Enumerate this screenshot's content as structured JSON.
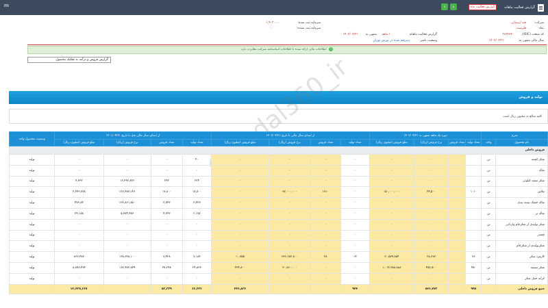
{
  "topbar": {
    "title": "گزارش فعالیت ماهانه",
    "corner": "EN",
    "report_badge": "گزارش فعالیت ماه"
  },
  "info": {
    "company_label": "شرکت:",
    "company_value": "قند لرستان",
    "symbol_label": "نماد:",
    "symbol_value": "قلرست",
    "code_label": "کد صنعت (ISIC):",
    "code_value": "۳۸۳۲۸۲",
    "period_label": "سال مالی منتهی به:",
    "period_value": "۱۴۰۲/۰۳/۳۱",
    "capital_label": "سرمایه ثبت شده:",
    "capital_value": "۱,۹۰۳,۰۰۰",
    "unreg_capital_label": "سرمایه ثبت نشده:",
    "unreg_capital_value": "۰",
    "report_label": "گزارش فعالیت ماهانه",
    "report_period": "۱ ماهه",
    "report_end_label": "منتهی به",
    "report_end_value": "۱۴۰۲/۰۴/۳۱",
    "status_label": "وضعیت ناشر:",
    "status_value": "پذیرفته شده در بورس تهران"
  },
  "notice": "اطلاعات مالی ارائه شده با اطلاعات اساسنامه شرکت مغایرت دارد",
  "select_value": "گزارش فروش و درآمد به تفکیک محصول",
  "section_title": "تولید و فروش",
  "hint": "کلیه مبالغ به میلیون ریال است",
  "table": {
    "headers_top": {
      "desc": "شرح",
      "period1": "دوره یک ماهه منتهی به ۱۴۰۲/۰۴/۳۱",
      "period2": "از ابتدای سال مالی تا تاریخ ۱۴۰۲/۰۴/۳۱",
      "period3": "از ابتدای سال مالی قبل تا تاریخ ۱۴۰۱/۰۴/۳۱",
      "status": "وضعیت محصول-واحد"
    },
    "headers_sub": [
      "نام محصول",
      "واحد",
      "تعداد تولید",
      "تعداد فروش",
      "نرخ فروش (ریال)",
      "مبلغ فروش (میلیون ریال)",
      "تعداد تولید",
      "تعداد فروش",
      "نرخ فروش (ریال)",
      "مبلغ فروش (میلیون ریال)",
      "تعداد تولید",
      "تعداد فروش",
      "نرخ فروش (ریال)",
      "مبلغ فروش (میلیون ریال)",
      ""
    ],
    "group_label": "فروش داخلی",
    "rows": [
      {
        "name": "شکر کیسه",
        "cells": [
          "تن",
          "",
          "",
          "۰",
          "۰",
          "۰",
          "۰",
          "۰",
          "۰",
          "۴۰",
          "۰",
          "۰",
          "۰",
          "تولید"
        ]
      },
      {
        "name": "تفاله",
        "cells": [
          "تن",
          "",
          "",
          "۰",
          "۰",
          "۰",
          "۰",
          "۰",
          "۰",
          "۰",
          "۰",
          "۰",
          "۰",
          "تولید"
        ]
      },
      {
        "name": "شکر سفید کیلوئی",
        "cells": [
          "تن",
          "",
          "",
          "۰",
          "۰",
          "۰",
          "۰",
          "۰",
          "۰",
          "۲۲۴",
          "۲۴۲",
          "۱۶,۲۹۲,۸۴۶",
          "۴,۳۳۲",
          "تولید"
        ]
      },
      {
        "name": "ملاس",
        "cells": [
          "تن",
          "۱۰۱۰",
          "",
          "۴۴,۵۰۰",
          "۱۵۰,۰۰۰,۰۰۰",
          "۰",
          "۱۷۱۰",
          "۳۷,۰۰۰,۰۰۰",
          "۰",
          "۱۷,۸۰۰",
          "۱۷,۸۰۰",
          "۱۲۶,۴۸۳,۱۴۶",
          "۲,۴۴۳,۷۷۸",
          "تولید"
        ]
      },
      {
        "name": "تفاله خشک بسته بندی",
        "cells": [
          "تن",
          "",
          "",
          "۰",
          "۰",
          "۰",
          "۰",
          "۰",
          "۰",
          "۳,۴۲۳",
          "۲,۷۴۳",
          "۱۳۲,۸۶۱,۸۸۰",
          "۴۷۳,۸۴",
          "تولید"
        ]
      },
      {
        "name": "تفاله تر",
        "cells": [
          "تن",
          "",
          "",
          "۰",
          "۰",
          "۰",
          "۰",
          "۰",
          "۰",
          "۲,۱۷۷",
          "۴,۲۴۳",
          "۵,۷۷۴,۴۸۳",
          "۲۹,۱۸۸",
          "تولید"
        ]
      },
      {
        "name": "شکر تولیدی از شکرخام وارداتی",
        "cells": [
          "تن",
          "",
          "",
          "۰",
          "۰",
          "۰",
          "۰",
          "۰",
          "۰",
          "۰",
          "۰",
          "۰",
          "۰",
          "تولید"
        ]
      },
      {
        "name": "چغندر",
        "cells": [
          "تن",
          "",
          "",
          "۰",
          "۰",
          "۰",
          "۰",
          "۰",
          "۰",
          "۰",
          "۰",
          "۰",
          "۰",
          "تولید"
        ]
      },
      {
        "name": "شکرتولیدی از شکرخام",
        "cells": [
          "تن",
          "",
          "",
          "۰",
          "۰",
          "۰",
          "۰",
          "۰",
          "۰",
          "۰",
          "۰",
          "۰",
          "۰",
          "تولید"
        ]
      },
      {
        "name": "کارمزد شکر",
        "cells": [
          "تن",
          "۷۶",
          "",
          "۲۸,۶۷۷",
          "۳۰,۵۷۹,۸۵۴",
          "۱۴",
          "۴۸",
          "۳۳۶,۶۸۲,۸۰۰",
          "۱۰,۷۵۵",
          "۷,۱۸۳",
          "۷,۴۲۸",
          "۱۲۸,۳۳۸,۱۰۰",
          "۸۶۳,۴۸۳",
          "تولید"
        ]
      },
      {
        "name": "شکر تصفیه",
        "cells": [
          "تن",
          "۴۵۰",
          "",
          "۴۵۶,۵۰۰",
          "۱,۰۱۴,۳۸۸,۸۸۸",
          "۰",
          "۰",
          "۳۰,۸۶۰,۰۰۰",
          "۴۲۴,۸۰۰",
          "۲۴,۸۲۳",
          "۴۷,۲۴۸",
          "۱۶۷,۴۷۳,۸۴۹",
          "۸,۸۹۶,۴۷۴",
          "تولید"
        ]
      },
      {
        "name": "کرایه حمل شکر",
        "cells": [
          "تن",
          "",
          "",
          "۰",
          "۰",
          "۰",
          "۰",
          "۰",
          "۰",
          "۰",
          "۰",
          "۰",
          "۰",
          "تولید"
        ]
      }
    ],
    "total": {
      "name": "جمع فروش داخلی",
      "cells": [
        "",
        "۹۹۷",
        "",
        "۵۲۲,۷۷۳",
        "",
        "۹۴۴",
        "",
        "",
        "۴۴۶,۸۳۶",
        "۶۶,۴۳۲",
        "۵۳,۳۳۹",
        "",
        "۲۲,۴۳۷,۶۶۷",
        ""
      ]
    }
  },
  "watermark": "@Codal360_ir"
}
